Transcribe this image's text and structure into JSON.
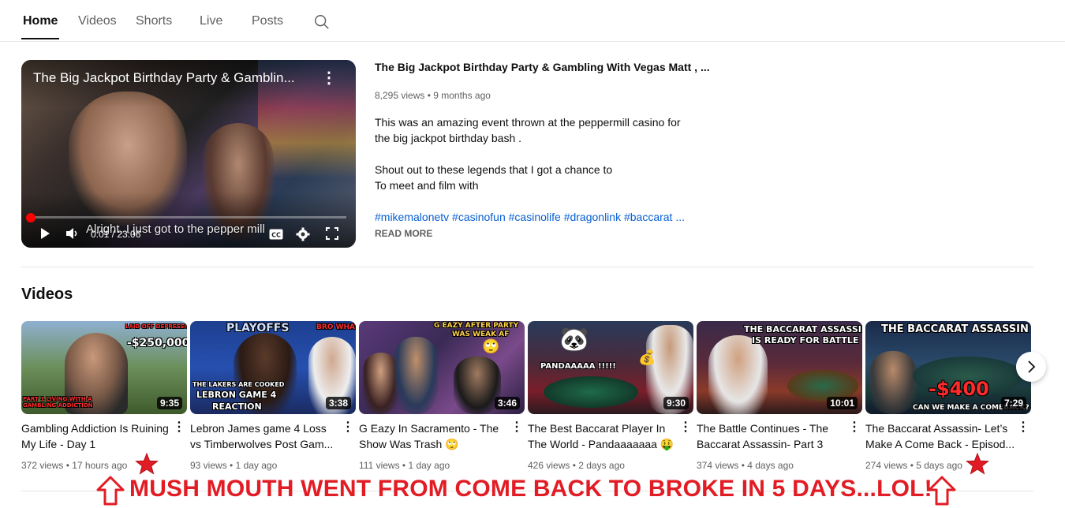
{
  "tabs": [
    {
      "label": "Home",
      "active": true
    },
    {
      "label": "Videos",
      "active": false
    },
    {
      "label": "Shorts",
      "active": false
    },
    {
      "label": "Live",
      "active": false
    },
    {
      "label": "Posts",
      "active": false
    }
  ],
  "search_icon": "search-icon",
  "featured": {
    "player_title": "The Big Jackpot Birthday Party & Gamblin...",
    "time": "0:01 / 23:06",
    "caption": "Alright, I just got to the pepper mill",
    "progress": 0.001,
    "title": "The Big Jackpot Birthday Party & Gambling With Vegas Matt , ...",
    "meta": "8,295 views • 9 months ago",
    "description": [
      "This was an amazing event thrown at the peppermill casino for",
      "the big jackpot birthday bash .",
      "Shout out to these legends that I got a chance to",
      "To meet and film with"
    ],
    "hashtags": "#mikemalonetv #casinofun #casinolife #dragonlink #baccarat ...",
    "read_more": "READ MORE"
  },
  "section": {
    "title": "Videos"
  },
  "videos": [
    {
      "title": "Gambling Addiction Is Ruining My Life - Day 1",
      "meta": "372 views • 17 hours ago",
      "duration": "9:35",
      "thumb_texts": [
        "LAID OFF DEPRESSION & GAMBLING HANGOVER",
        "-$250,000",
        "PART 1 LIVING WITH A GAMBLING ADDICTION"
      ]
    },
    {
      "title": "Lebron James game 4 Loss vs Timberwolves Post Gam...",
      "meta": "93 views • 1 day ago",
      "duration": "3:38",
      "thumb_texts": [
        "PLAYOFFS",
        "BRO WHAT??",
        "THE LAKERS ARE COOKED",
        "LEBRON GAME 4",
        "REACTION"
      ]
    },
    {
      "title": "G Eazy In Sacramento - The Show Was Trash 🙄",
      "meta": "111 views • 1 day ago",
      "duration": "3:46",
      "thumb_texts": [
        "G EAZY AFTER PARTY",
        "WAS WEAK AF",
        "🙄"
      ]
    },
    {
      "title": "The Best Baccarat Player In The World - Pandaaaaaaa 🤑",
      "meta": "426 views • 2 days ago",
      "duration": "9:30",
      "thumb_texts": [
        "🐼",
        "PANDAAAAA !!!!!",
        "💰"
      ]
    },
    {
      "title": "The Battle Continues - The Baccarat Assassin- Part 3",
      "meta": "374 views • 4 days ago",
      "duration": "10:01",
      "thumb_texts": [
        "THE BACCARAT ASSASSIN",
        "IS READY FOR BATTLE"
      ]
    },
    {
      "title": "The Baccarat Assassin- Let’s Make A Come Back - Episod...",
      "meta": "274 views • 5 days ago",
      "duration": "7:29",
      "thumb_texts": [
        "THE BACCARAT ASSASSIN",
        "-$400",
        "CAN WE MAKE A COMEBACK?"
      ]
    }
  ],
  "annotation": {
    "text": "MUSH MOUTH WENT FROM COME BACK TO BROKE IN 5 DAYS...LOL!",
    "color": "#e21c24"
  },
  "colors": {
    "accent_red": "#ff0000",
    "link_blue": "#065fd4",
    "meta_gray": "#606060"
  }
}
